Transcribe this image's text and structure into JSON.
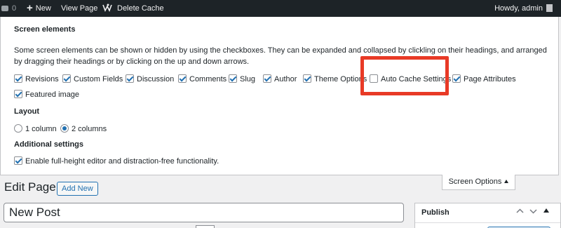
{
  "admin_bar": {
    "comments_count": "0",
    "new_label": "New",
    "view_page_label": "View Page",
    "delete_cache_label": "Delete Cache",
    "howdy_label": "Howdy, admin"
  },
  "screen_options": {
    "heading": "Screen elements",
    "description": "Some screen elements can be shown or hidden by using the checkboxes. They can be expanded and collapsed by clickling on their headings, and arranged by dragging their headings or by clicking on the up and down arrows.",
    "elements": [
      {
        "label": "Revisions",
        "checked": true
      },
      {
        "label": "Custom Fields",
        "checked": true
      },
      {
        "label": "Discussion",
        "checked": true
      },
      {
        "label": "Comments",
        "checked": true
      },
      {
        "label": "Slug",
        "checked": true
      },
      {
        "label": "Author",
        "checked": true
      },
      {
        "label": "Theme Options",
        "checked": true
      },
      {
        "label": "Auto Cache Settings",
        "checked": false
      },
      {
        "label": "Page Attributes",
        "checked": true
      },
      {
        "label": "Featured image",
        "checked": true
      }
    ],
    "layout_heading": "Layout",
    "layout_options": [
      {
        "label": "1 column",
        "checked": false
      },
      {
        "label": "2 columns",
        "checked": true
      }
    ],
    "additional_heading": "Additional settings",
    "additional_option": {
      "label": "Enable full-height editor and distraction-free functionality.",
      "checked": true
    },
    "tab_label": "Screen Options"
  },
  "page": {
    "title": "Edit Page",
    "add_new_label": "Add New",
    "post_title_value": "New Post"
  },
  "publish": {
    "title": "Publish"
  },
  "colors": {
    "admin_bar_bg": "#1d2327",
    "accent": "#2271b1",
    "highlight": "#e83a26"
  }
}
